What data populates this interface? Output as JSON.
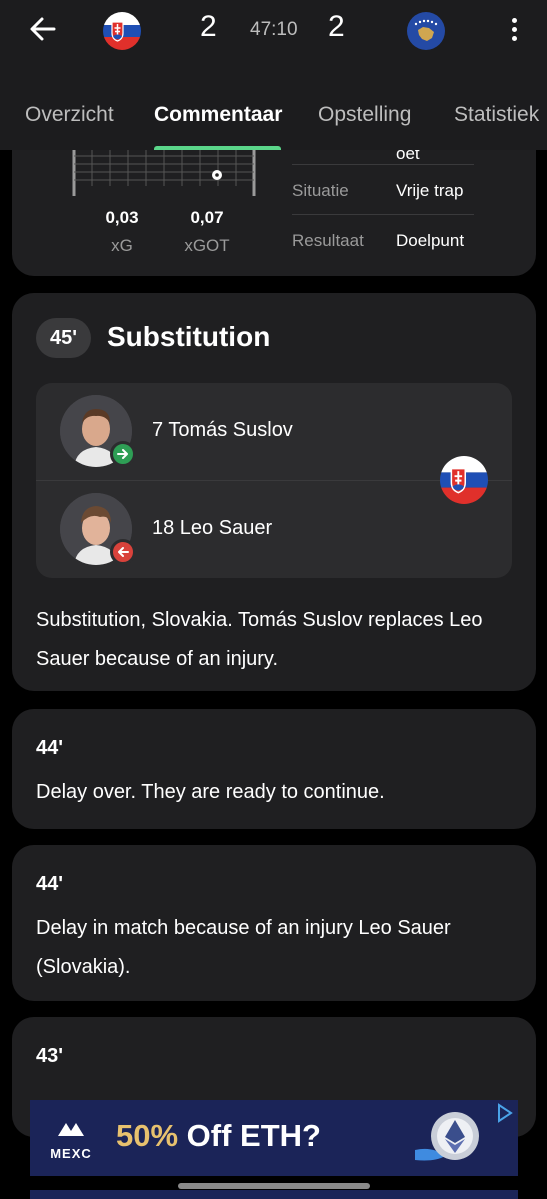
{
  "header": {
    "home_score": "2",
    "away_score": "2",
    "clock": "47:10",
    "home_flag": "slovakia-flag",
    "away_flag": "kosovo-flag"
  },
  "tabs": [
    {
      "label": "Overzicht",
      "active": false
    },
    {
      "label": "Commentaar",
      "active": true
    },
    {
      "label": "Opstelling",
      "active": false
    },
    {
      "label": "Statistiek",
      "active": false
    }
  ],
  "shot_card": {
    "partial_text": "oet",
    "xg_value": "0,03",
    "xg_label": "xG",
    "xgot_value": "0,07",
    "xgot_label": "xGOT",
    "rows": [
      {
        "label": "Situatie",
        "value": "Vrije trap"
      },
      {
        "label": "Resultaat",
        "value": "Doelpunt"
      }
    ]
  },
  "substitution": {
    "minute": "45'",
    "title": "Substitution",
    "player_in": "7 Tomás Suslov",
    "player_out": "18 Leo Sauer",
    "text": "Substitution, Slovakia. Tomás Suslov replaces Leo Sauer because of an injury."
  },
  "comments": [
    {
      "minute": "44'",
      "text": "Delay over. They are ready to continue."
    },
    {
      "minute": "44'",
      "text": "Delay in match because of an injury Leo Sauer (Slovakia)."
    },
    {
      "minute": "43'",
      "text": ""
    }
  ],
  "ad": {
    "brand": "MEXC",
    "discount": "50%",
    "headline_rest": " Off ETH?"
  },
  "colors": {
    "background": "#000000",
    "card": "#1f1f21",
    "accent_green": "#5bd68a",
    "sub_in": "#2e9e55",
    "sub_out": "#d9423b"
  }
}
